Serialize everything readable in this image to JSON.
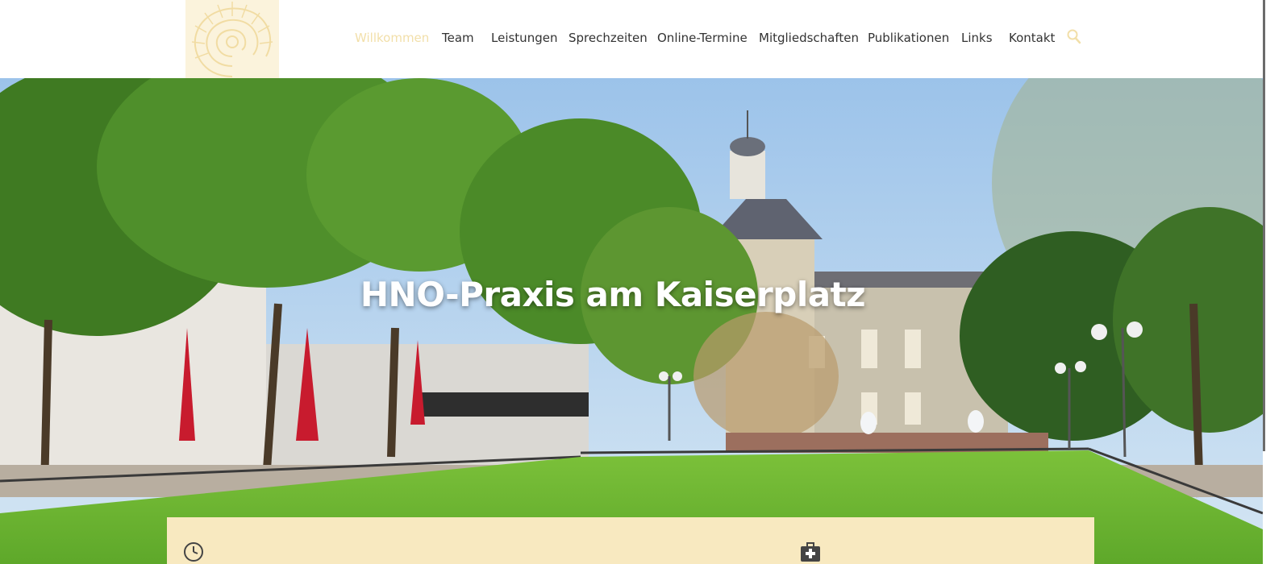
{
  "nav": {
    "items": [
      {
        "label": "Willkommen",
        "active": true
      },
      {
        "label": "Team"
      },
      {
        "label": "Leistungen"
      },
      {
        "label": "Sprechzeiten"
      },
      {
        "label": "Online-Termine"
      },
      {
        "label": "Mitgliedschaften"
      },
      {
        "label": "Publikationen"
      },
      {
        "label": "Links"
      },
      {
        "label": "Kontakt"
      }
    ],
    "search_icon": "search-icon"
  },
  "hero": {
    "title": "HNO-Praxis am Kaiserplatz"
  },
  "info_box": {
    "icons": [
      "clock-icon",
      "medical-kit-icon"
    ]
  },
  "colors": {
    "accent": "#f2dfa9",
    "logo_bg": "#fbf3dc",
    "info_box_bg": "#f8e9c0",
    "nav_text": "#333333"
  }
}
